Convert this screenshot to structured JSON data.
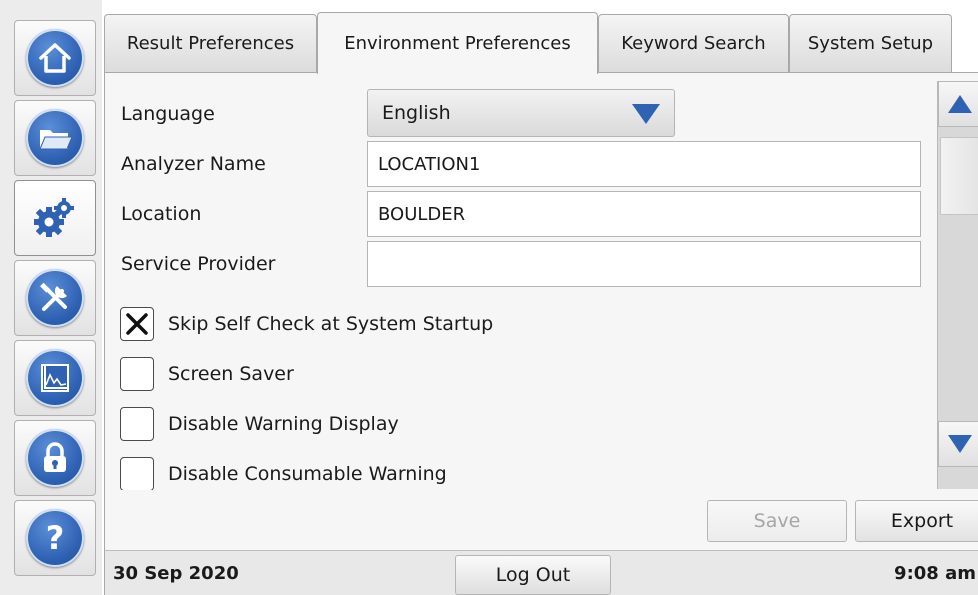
{
  "nav": {
    "items": [
      {
        "icon": "home-icon"
      },
      {
        "icon": "folder-icon"
      },
      {
        "icon": "settings-gears-icon"
      },
      {
        "icon": "tools-icon"
      },
      {
        "icon": "chart-icon"
      },
      {
        "icon": "lock-icon"
      },
      {
        "icon": "help-icon"
      }
    ]
  },
  "tabs": [
    {
      "label": "Result Preferences"
    },
    {
      "label": "Environment Preferences",
      "active": true
    },
    {
      "label": "Keyword Search"
    },
    {
      "label": "System Setup"
    }
  ],
  "form": {
    "language": {
      "label": "Language",
      "value": "English"
    },
    "analyzer_name": {
      "label": "Analyzer Name",
      "value": "LOCATION1"
    },
    "location": {
      "label": "Location",
      "value": "BOULDER"
    },
    "service_provider": {
      "label": "Service Provider",
      "value": ""
    },
    "checkboxes": [
      {
        "label": "Skip Self Check at System Startup",
        "checked": true
      },
      {
        "label": "Screen Saver",
        "checked": false
      },
      {
        "label": "Disable Warning Display",
        "checked": false
      },
      {
        "label": "Disable Consumable Warning",
        "checked": false
      }
    ]
  },
  "actions": {
    "save_label": "Save",
    "save_enabled": false,
    "export_label": "Export"
  },
  "status": {
    "date": "30 Sep 2020",
    "logout_label": "Log Out",
    "time": "9:08 am"
  },
  "colors": {
    "accent_blue": "#2f62b3",
    "panel_bg": "#f6f6f6"
  }
}
